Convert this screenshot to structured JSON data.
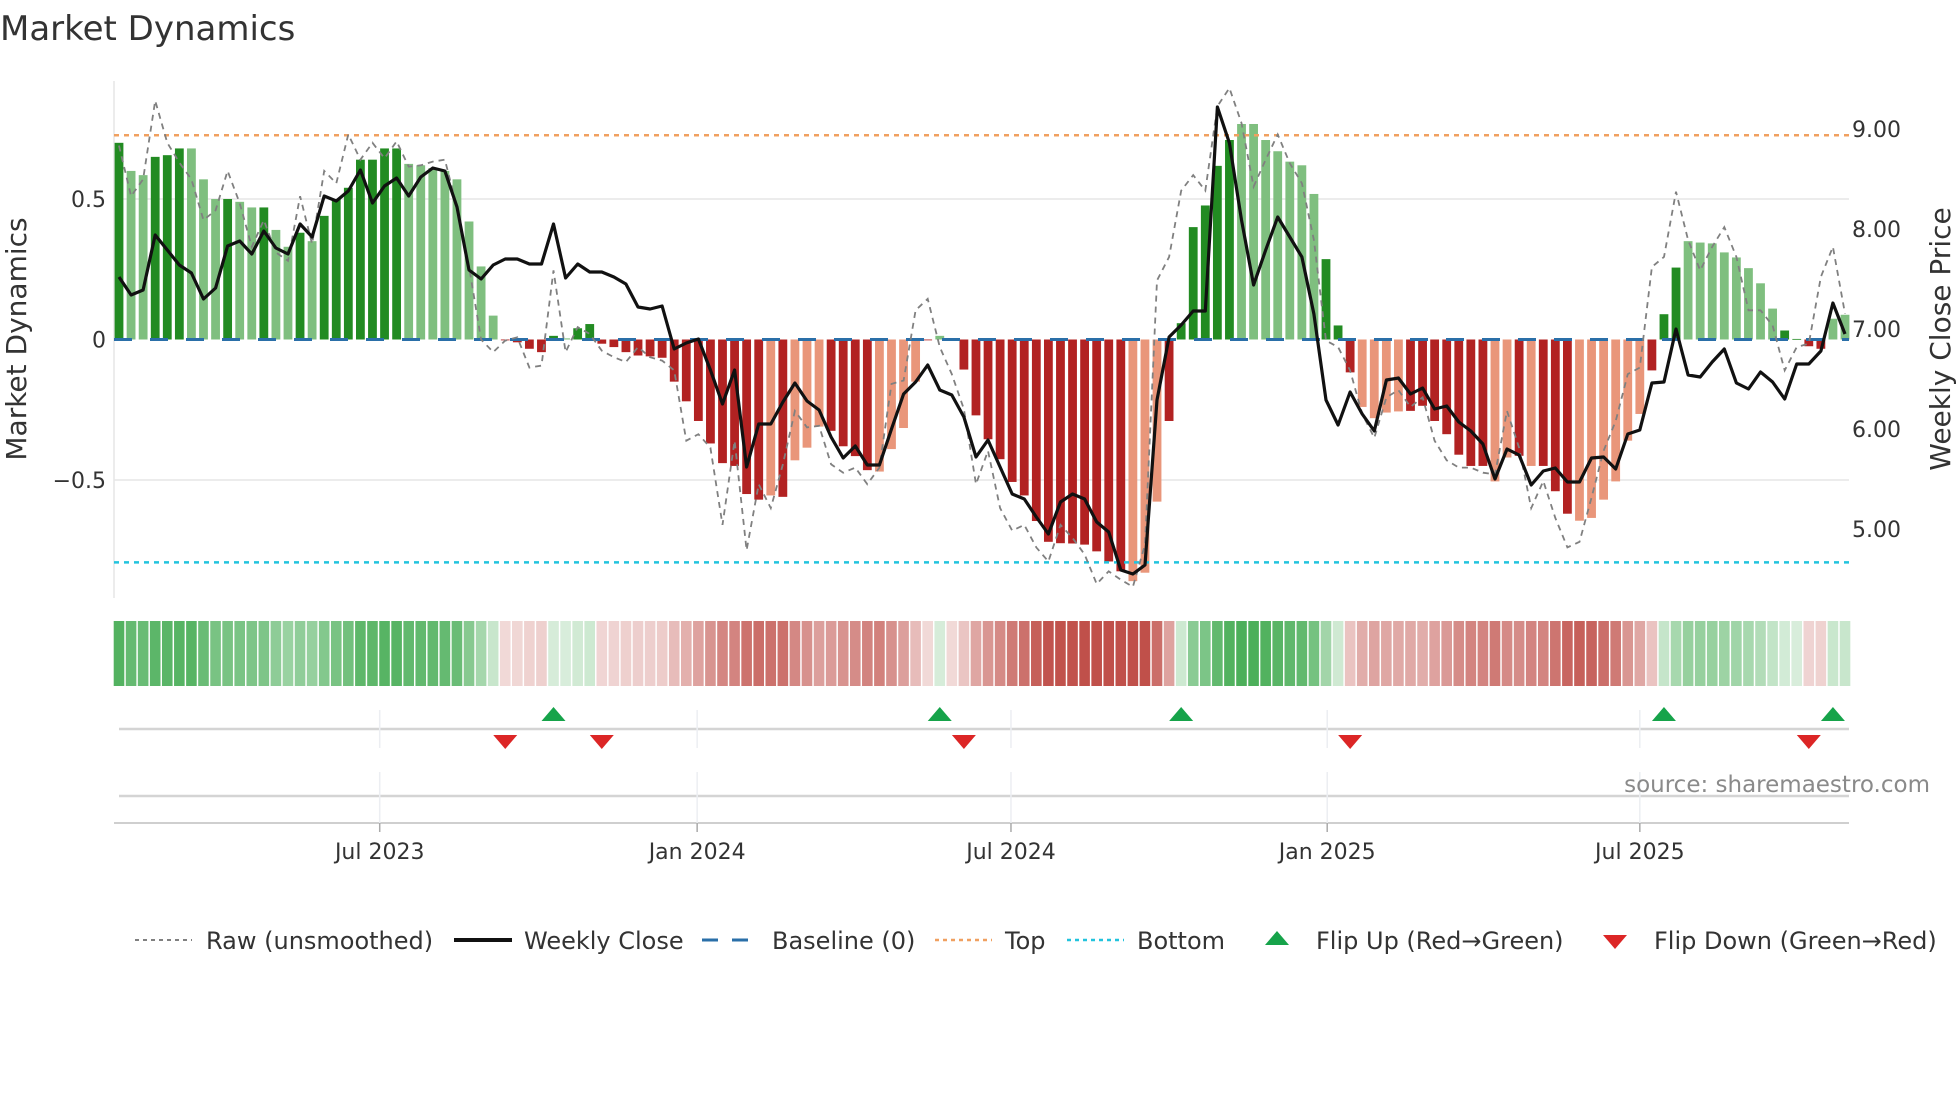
{
  "chart_data": {
    "type": "bar",
    "title": "Market Dynamics",
    "ylabel": "Market Dynamics",
    "ylabel_right": "Weekly Close Price",
    "source": "source: sharemaestro.com",
    "ylim": [
      -0.92,
      0.92
    ],
    "ylim_right": [
      4.31,
      9.48
    ],
    "y_ticks": [
      {
        "value": 0.5,
        "label": "0.5"
      },
      {
        "value": 0,
        "label": "0"
      },
      {
        "value": -0.5,
        "label": "−0.5"
      }
    ],
    "y_ticks_right": [
      {
        "value": 9,
        "label": "9.00"
      },
      {
        "value": 8,
        "label": "8.00"
      },
      {
        "value": 7,
        "label": "7.00"
      },
      {
        "value": 6,
        "label": "6.00"
      },
      {
        "value": 5,
        "label": "5.00"
      }
    ],
    "x_unit": "week index",
    "x_ticks": [
      {
        "week": 21.6,
        "label": "Jul 2023"
      },
      {
        "week": 47.9,
        "label": "Jan 2024"
      },
      {
        "week": 73.9,
        "label": "Jul 2024"
      },
      {
        "week": 100.1,
        "label": "Jan 2025"
      },
      {
        "week": 126.0,
        "label": "Jul 2025"
      }
    ],
    "top_level": 0.727,
    "bottom_level": -0.793,
    "baseline": 0,
    "dynamics": [
      0.7,
      0.6,
      0.585,
      0.65,
      0.656,
      0.68,
      0.68,
      0.57,
      0.5,
      0.5,
      0.49,
      0.47,
      0.47,
      0.39,
      0.33,
      0.38,
      0.35,
      0.44,
      0.5,
      0.54,
      0.64,
      0.64,
      0.68,
      0.68,
      0.625,
      0.62,
      0.61,
      0.6,
      0.57,
      0.42,
      0.26,
      0.085,
      -0.003,
      -0.01,
      -0.033,
      -0.045,
      0.013,
      0.004,
      0.04,
      0.055,
      -0.015,
      -0.027,
      -0.045,
      -0.057,
      -0.06,
      -0.065,
      -0.15,
      -0.22,
      -0.29,
      -0.37,
      -0.44,
      -0.45,
      -0.55,
      -0.57,
      -0.555,
      -0.56,
      -0.43,
      -0.385,
      -0.31,
      -0.325,
      -0.38,
      -0.415,
      -0.465,
      -0.47,
      -0.39,
      -0.315,
      -0.15,
      -0.003,
      0.013,
      -0.002,
      -0.107,
      -0.27,
      -0.355,
      -0.426,
      -0.507,
      -0.555,
      -0.646,
      -0.72,
      -0.725,
      -0.726,
      -0.73,
      -0.754,
      -0.79,
      -0.825,
      -0.86,
      -0.83,
      -0.577,
      -0.29,
      0.058,
      0.4,
      0.477,
      0.618,
      0.71,
      0.767,
      0.767,
      0.71,
      0.67,
      0.633,
      0.62,
      0.518,
      0.286,
      0.05,
      -0.117,
      -0.24,
      -0.28,
      -0.26,
      -0.256,
      -0.254,
      -0.236,
      -0.29,
      -0.337,
      -0.41,
      -0.45,
      -0.45,
      -0.505,
      -0.42,
      -0.414,
      -0.45,
      -0.45,
      -0.54,
      -0.62,
      -0.645,
      -0.635,
      -0.57,
      -0.505,
      -0.36,
      -0.265,
      -0.11,
      0.09,
      0.256,
      0.35,
      0.345,
      0.342,
      0.31,
      0.292,
      0.254,
      0.2,
      0.11,
      0.032,
      0.002,
      -0.024,
      -0.033,
      0.074,
      0.088
    ],
    "shade": "DLLDDDLLLDLLDLLDLDDDDDDDLLLLLLLLDDDDDLDDDDDDDDDDDDDDDDLDLLLDDDDLLLLDLDDDDDDDDDDDDDDDLLLDDDDDDLLLLLLLDDDLLLLDDDDDDDLLDLDDDLLLLLLDDDLLLLLLLLDDDD",
    "raw": [
      0.69,
      0.51,
      0.57,
      0.85,
      0.7,
      0.63,
      0.57,
      0.425,
      0.46,
      0.6,
      0.485,
      0.33,
      0.425,
      0.31,
      0.28,
      0.51,
      0.34,
      0.6,
      0.556,
      0.73,
      0.64,
      0.7,
      0.645,
      0.705,
      0.615,
      0.62,
      0.633,
      0.64,
      0.47,
      0.26,
      0.0,
      -0.045,
      -0.004,
      0.008,
      -0.1,
      -0.093,
      0.246,
      -0.045,
      0.044,
      0.02,
      -0.04,
      -0.063,
      -0.08,
      -0.027,
      -0.063,
      -0.075,
      -0.11,
      -0.36,
      -0.337,
      -0.385,
      -0.66,
      -0.36,
      -0.75,
      -0.515,
      -0.6,
      -0.444,
      -0.254,
      -0.313,
      -0.307,
      -0.444,
      -0.474,
      -0.456,
      -0.515,
      -0.456,
      -0.158,
      -0.146,
      0.104,
      0.145,
      -0.027,
      -0.123,
      -0.248,
      -0.515,
      -0.396,
      -0.6,
      -0.68,
      -0.66,
      -0.74,
      -0.79,
      -0.66,
      -0.706,
      -0.765,
      -0.87,
      -0.825,
      -0.855,
      -0.88,
      -0.73,
      0.21,
      0.294,
      0.53,
      0.585,
      0.53,
      0.83,
      0.895,
      0.77,
      0.544,
      0.64,
      0.73,
      0.627,
      0.556,
      0.354,
      -0.004,
      -0.027,
      -0.11,
      -0.265,
      -0.35,
      -0.206,
      -0.18,
      -0.24,
      -0.206,
      -0.36,
      -0.43,
      -0.456,
      -0.456,
      -0.474,
      -0.48,
      -0.254,
      -0.385,
      -0.6,
      -0.504,
      -0.635,
      -0.74,
      -0.72,
      -0.563,
      -0.396,
      -0.29,
      -0.123,
      -0.1,
      0.258,
      0.294,
      0.526,
      0.354,
      0.246,
      0.33,
      0.4,
      0.294,
      0.104,
      0.104,
      0.05,
      -0.11,
      -0.027,
      -0.015,
      0.223,
      0.33,
      0.092
    ],
    "weekly_close": [
      7.52,
      7.34,
      7.39,
      7.94,
      7.79,
      7.64,
      7.56,
      7.3,
      7.41,
      7.83,
      7.88,
      7.75,
      7.98,
      7.81,
      7.75,
      8.05,
      7.92,
      8.33,
      8.28,
      8.38,
      8.59,
      8.26,
      8.43,
      8.51,
      8.33,
      8.52,
      8.61,
      8.58,
      8.22,
      7.59,
      7.5,
      7.64,
      7.7,
      7.7,
      7.65,
      7.65,
      8.05,
      7.51,
      7.65,
      7.57,
      7.57,
      7.52,
      7.45,
      7.22,
      7.2,
      7.23,
      6.8,
      6.86,
      6.9,
      6.59,
      6.25,
      6.59,
      5.62,
      6.05,
      6.05,
      6.27,
      6.46,
      6.28,
      6.19,
      5.92,
      5.71,
      5.83,
      5.64,
      5.64,
      6.0,
      6.35,
      6.47,
      6.64,
      6.39,
      6.34,
      6.12,
      5.72,
      5.89,
      5.62,
      5.35,
      5.3,
      5.12,
      4.95,
      5.27,
      5.35,
      5.3,
      5.07,
      4.97,
      4.59,
      4.55,
      4.64,
      6.29,
      6.92,
      7.04,
      7.18,
      7.18,
      9.22,
      8.86,
      8.09,
      7.44,
      7.79,
      8.12,
      7.92,
      7.72,
      7.15,
      6.29,
      6.04,
      6.37,
      6.15,
      5.98,
      6.49,
      6.51,
      6.35,
      6.41,
      6.2,
      6.23,
      6.07,
      5.98,
      5.85,
      5.5,
      5.8,
      5.74,
      5.44,
      5.58,
      5.61,
      5.47,
      5.47,
      5.71,
      5.72,
      5.6,
      5.95,
      5.99,
      6.46,
      6.47,
      7.0,
      6.54,
      6.52,
      6.67,
      6.8,
      6.46,
      6.4,
      6.57,
      6.47,
      6.3,
      6.65,
      6.65,
      6.78,
      7.26,
      6.95
    ],
    "flip_up_weeks": [
      36,
      68,
      88,
      128,
      142
    ],
    "flip_down_weeks": [
      32,
      40,
      70,
      102,
      140
    ],
    "legend": {
      "raw": "Raw (unsmoothed)",
      "close": "Weekly Close",
      "baseline": "Baseline (0)",
      "top": "Top",
      "bottom": "Bottom",
      "flip_up": "Flip Up (Red→Green)",
      "flip_down": "Flip Down (Green→Red)"
    },
    "colors": {
      "green_strong": "#228b22",
      "green_weak": "#7fbf7f",
      "red_strong": "#b22222",
      "red_weak": "#e9967a",
      "raw": "#808080",
      "close": "#111111",
      "baseline": "#2a6fa8",
      "top": "#f0a060",
      "bottom": "#22c3dd",
      "flip_up": "#16a34a",
      "flip_down": "#dc2626",
      "strip_green": "#4caf5a",
      "strip_red": "#c0504a"
    }
  }
}
